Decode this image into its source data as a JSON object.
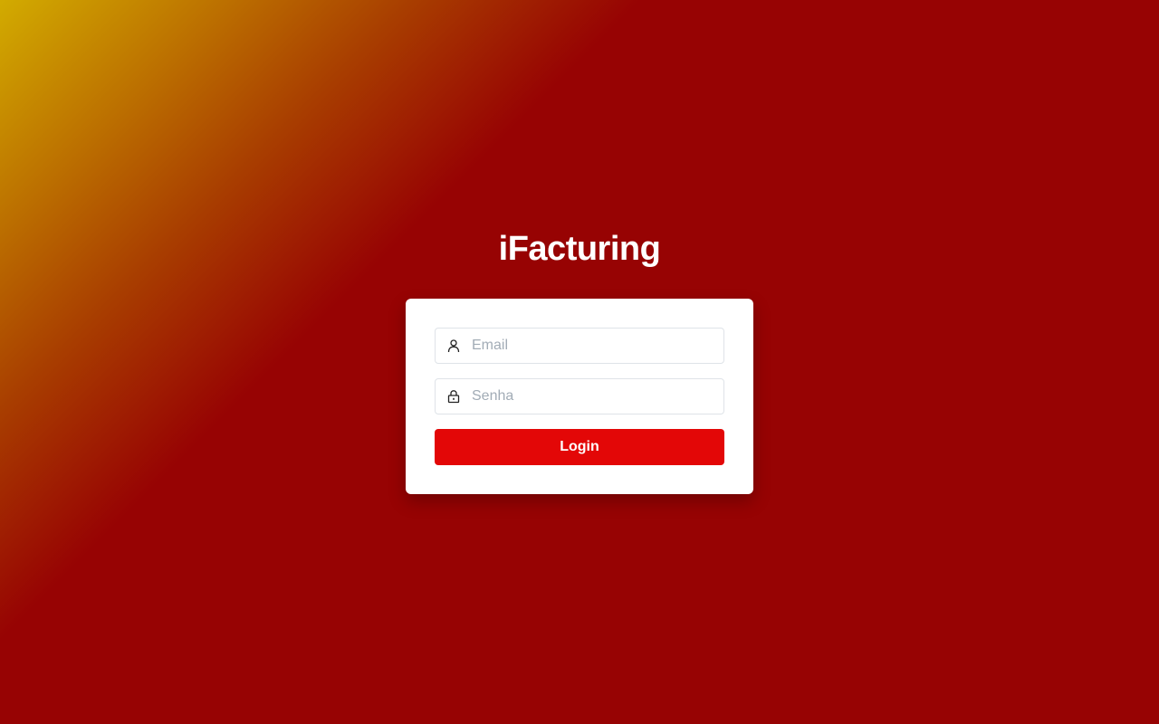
{
  "brand": {
    "title": "iFacturing"
  },
  "login_form": {
    "email": {
      "placeholder": "Email",
      "value": "",
      "icon": "user-icon"
    },
    "password": {
      "placeholder": "Senha",
      "value": "",
      "icon": "lock-icon"
    },
    "submit_label": "Login"
  },
  "colors": {
    "background": "#970303",
    "glow_start": "#d2ab00",
    "button": "#e30707",
    "card": "#ffffff",
    "placeholder": "#a2acb6"
  }
}
